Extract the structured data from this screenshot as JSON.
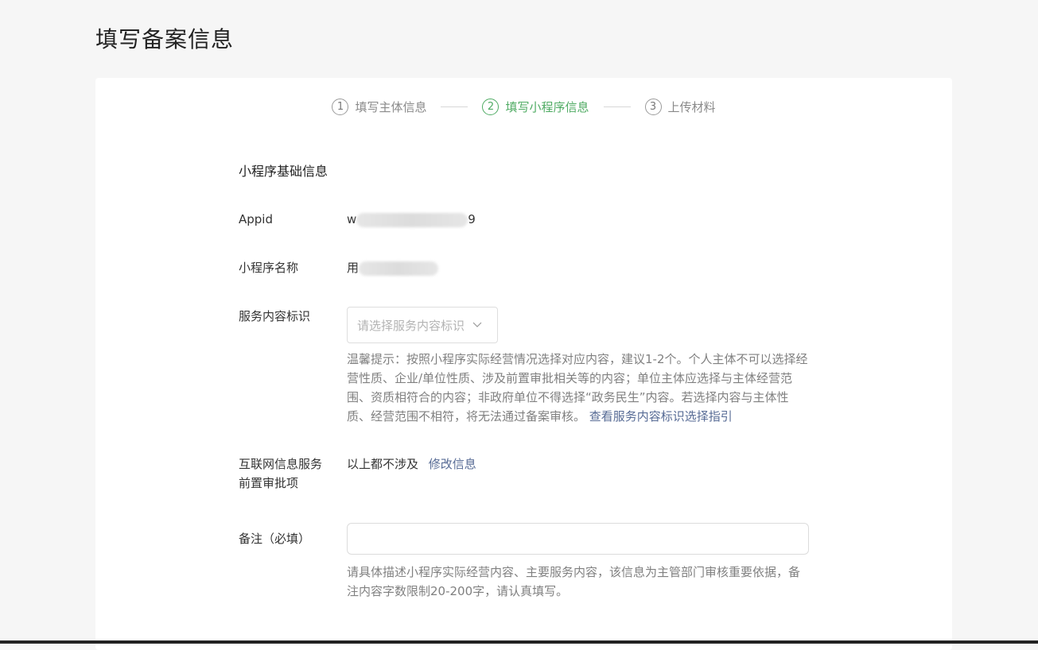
{
  "page": {
    "title": "填写备案信息"
  },
  "steps": [
    {
      "num": "1",
      "label": "填写主体信息",
      "state": "done"
    },
    {
      "num": "2",
      "label": "填写小程序信息",
      "state": "active"
    },
    {
      "num": "3",
      "label": "上传材料",
      "state": "todo"
    }
  ],
  "form": {
    "section_title": "小程序基础信息",
    "appid": {
      "label": "Appid",
      "value_prefix": "w",
      "value_suffix": "9"
    },
    "app_name": {
      "label": "小程序名称",
      "value_prefix": "用"
    },
    "service_tag": {
      "label": "服务内容标识",
      "placeholder": "请选择服务内容标识",
      "tip": "温馨提示：按照小程序实际经营情况选择对应内容，建议1-2个。个人主体不可以选择经营性质、企业/单位性质、涉及前置审批相关等的内容；单位主体应选择与主体经营范围、资质相符合的内容；非政府单位不得选择“政务民生”内容。若选择内容与主体性质、经营范围不相符，将无法通过备案审核。",
      "tip_link": "查看服务内容标识选择指引"
    },
    "pre_approval": {
      "label": "互联网信息服务前置审批项",
      "value": "以上都不涉及",
      "edit_link": "修改信息"
    },
    "remark": {
      "label": "备注（必填）",
      "placeholder": "",
      "tip": "请具体描述小程序实际经营内容、主要服务内容，该信息为主管部门审核重要依据，备注内容字数限制20-200字，请认真填写。"
    }
  },
  "colors": {
    "active_step": "#4fab63",
    "link": "#576b95",
    "background": "#f6f6f6"
  }
}
